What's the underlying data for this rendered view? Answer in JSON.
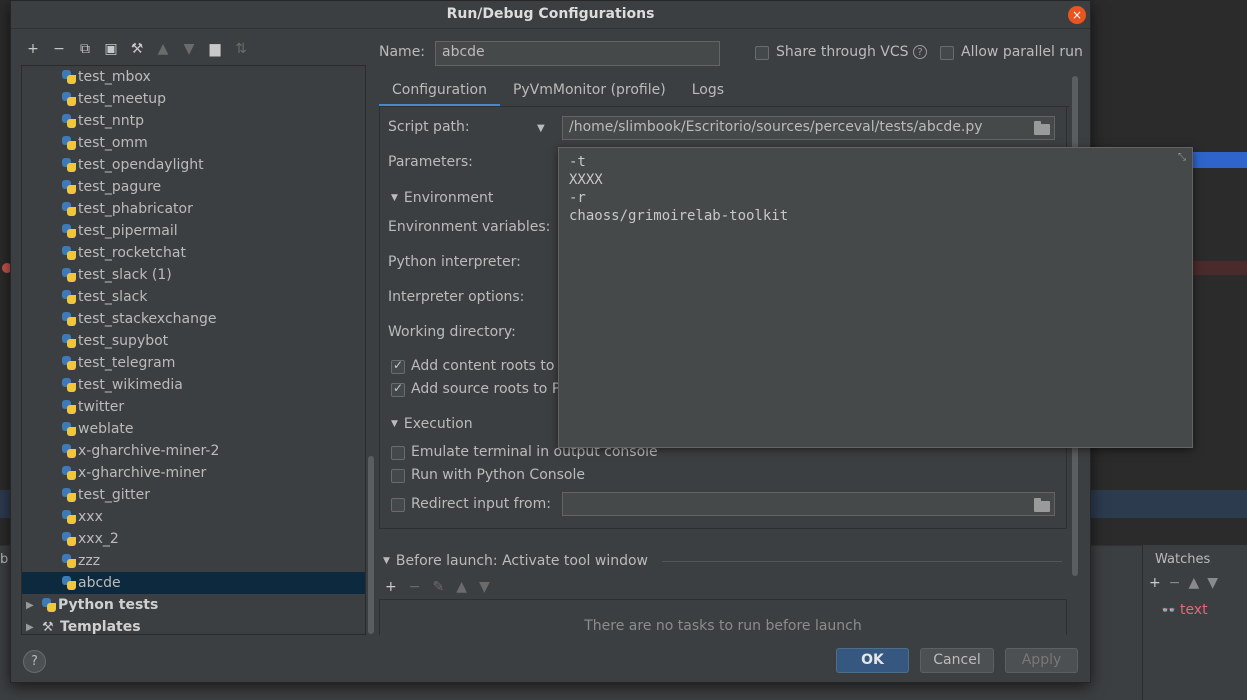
{
  "dialog": {
    "title": "Run/Debug Configurations",
    "close_glyph": "×"
  },
  "left_toolbar": {
    "icons": [
      "plus-icon",
      "minus-icon",
      "copy-icon",
      "save-icon",
      "wrench-icon",
      "move-up-icon",
      "move-down-icon",
      "folder-icon",
      "sort-icon"
    ],
    "glyphs": [
      "+",
      "−",
      "⧉",
      "▣",
      "🔧",
      "▲",
      "▼",
      "▆",
      "⇅"
    ]
  },
  "tree": {
    "items": [
      "test_mbox",
      "test_meetup",
      "test_nntp",
      "test_omm",
      "test_opendaylight",
      "test_pagure",
      "test_phabricator",
      "test_pipermail",
      "test_rocketchat",
      "test_slack (1)",
      "test_slack",
      "test_stackexchange",
      "test_supybot",
      "test_telegram",
      "test_wikimedia",
      "twitter",
      "weblate",
      "x-gharchive-miner-2",
      "x-gharchive-miner",
      "test_gitter",
      "xxx",
      "xxx_2",
      "zzz",
      "abcde"
    ],
    "selected": "abcde",
    "groups": [
      "Python tests",
      "Templates"
    ]
  },
  "header": {
    "name_label": "Name:",
    "name_value": "abcde",
    "share_vcs_label": "Share through VCS",
    "help_glyph": "?",
    "parallel_label": "Allow parallel run"
  },
  "tabs": [
    "Configuration",
    "PyVmMonitor (profile)",
    "Logs"
  ],
  "config": {
    "script_path_label": "Script path:",
    "script_path_value": "/home/slimbook/Escritorio/sources/perceval/tests/abcde.py",
    "parameters_label": "Parameters:",
    "environment_section": "Environment",
    "env_vars_label": "Environment variables:",
    "python_interpreter_label": "Python interpreter:",
    "interpreter_options_label": "Interpreter options:",
    "working_dir_label": "Working directory:",
    "add_content_roots_label": "Add content roots to",
    "add_source_roots_label": "Add source roots to P",
    "execution_section": "Execution",
    "emulate_terminal_label": "Emulate terminal in output console",
    "run_python_console_label": "Run with Python Console",
    "redirect_input_label": "Redirect input from:"
  },
  "params_popup": {
    "lines": [
      "-t",
      "XXXX",
      "-r",
      "chaoss/grimoirelab-toolkit"
    ]
  },
  "before_launch": {
    "section": "Before launch: Activate tool window",
    "empty_text": "There are no tasks to run before launch"
  },
  "buttons": {
    "help": "?",
    "ok": "OK",
    "cancel": "Cancel",
    "apply": "Apply"
  },
  "watches": {
    "title": "Watches",
    "item": "text"
  },
  "background": {
    "left_char": "b"
  },
  "colors": {
    "accent_tab": "#4a88c7",
    "ok_button": "#365880",
    "selection": "#0d293e",
    "close_button": "#e95420"
  }
}
